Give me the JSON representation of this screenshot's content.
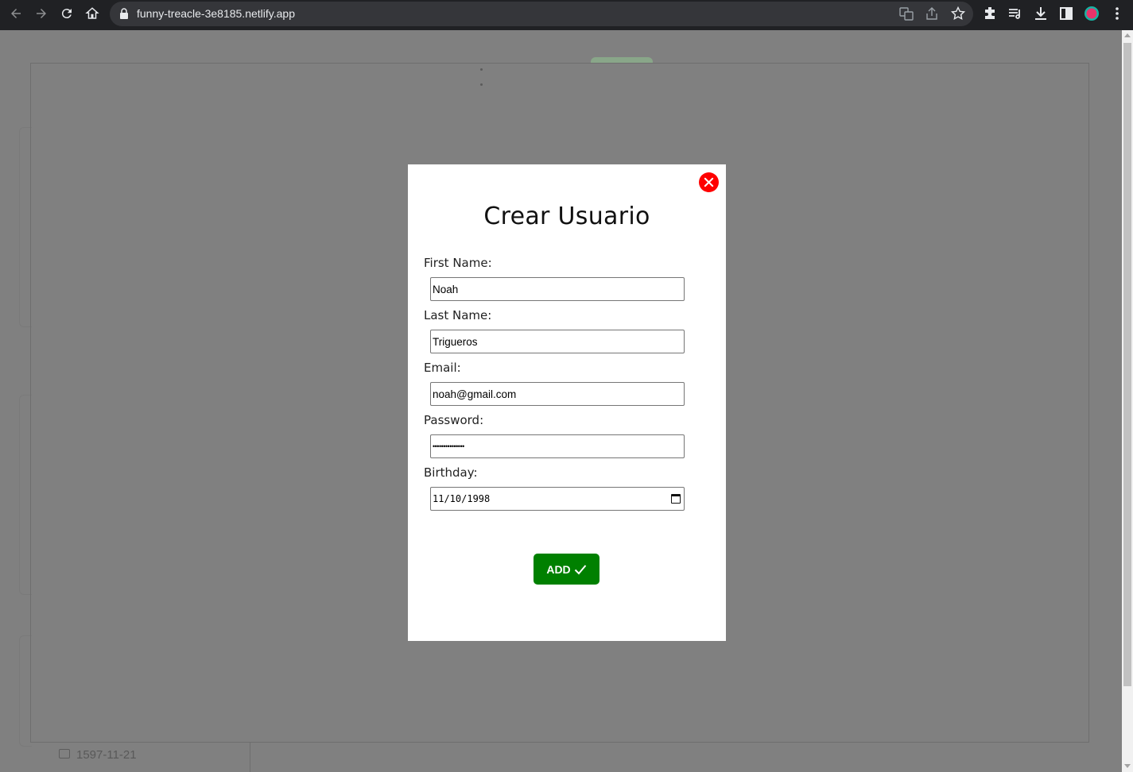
{
  "browser": {
    "url": "funny-treacle-3e8185.netlify.app"
  },
  "background": {
    "visible_date": "1597-11-21"
  },
  "modal": {
    "title": "Crear Usuario",
    "fields": [
      {
        "label": "First Name:",
        "value": "Noah"
      },
      {
        "label": "Last Name:",
        "value": "Trigueros"
      },
      {
        "label": "Email:",
        "value": "noah@gmail.com"
      },
      {
        "label": "Password:",
        "value": "•••••••••••••••"
      },
      {
        "label": "Birthday:",
        "value": "11/10/1998"
      }
    ],
    "submit_label": "ADD",
    "colors": {
      "close": "#ff0000",
      "submit": "#008000"
    }
  }
}
